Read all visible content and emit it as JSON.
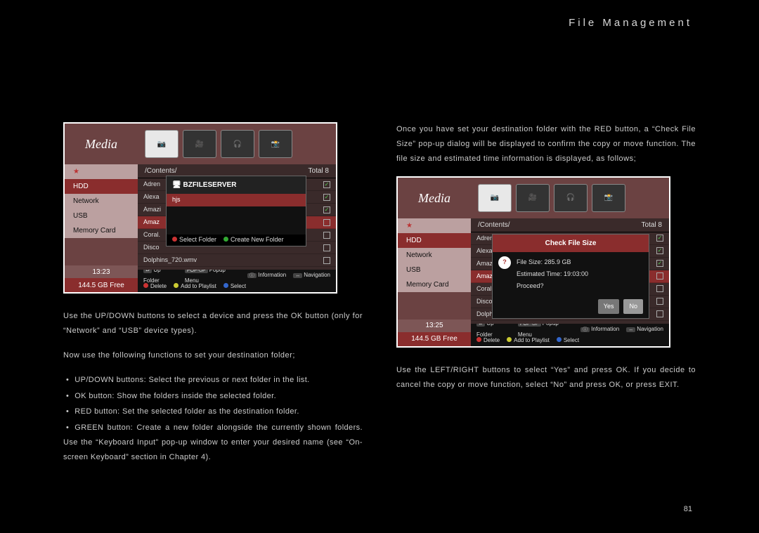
{
  "header": {
    "title": "File Management"
  },
  "page_number": "81",
  "left": {
    "p1": "Use the UP/DOWN buttons to select a device and press the OK button (only for “Network” and “USB” device types).",
    "p2": "Now use the following functions to set your destination folder;",
    "bullets": [
      "UP/DOWN buttons: Select the previous or next folder in the list.",
      "OK button: Show the folders inside the selected folder.",
      "RED button: Set the selected folder as the destination folder.",
      "GREEN button: Create a new folder alongside the currently shown folders.  Use the “Keyboard Input” pop-up window to enter your desired name (see “On-screen Keyboard” section in Chapter 4)."
    ]
  },
  "right": {
    "p1": "Once you have set your destination folder with the RED button, a “Check File Size” pop-up dialog will be displayed to confirm the copy or move function.  The file size and estimated time information is displayed, as follows;",
    "p2": "Use the LEFT/RIGHT buttons to select “Yes” and press OK.  If you decide to cancel the copy or move function, select “No” and press OK, or press EXIT."
  },
  "shot1": {
    "media": "Media",
    "path": "/Contents/",
    "total": "Total 8",
    "side": {
      "hdd": "HDD",
      "net": "Network",
      "usb": "USB",
      "mc": "Memory Card",
      "time": "13:23",
      "free": "144.5 GB Free"
    },
    "rows": [
      "Adren",
      "Alexa",
      "Amazi",
      "Amaz",
      "Coral.",
      "Disco",
      "Dolphins_720.wmv"
    ],
    "popup": {
      "title": "BZFILESERVER",
      "row": "hjs",
      "hints": {
        "select": "Select Folder",
        "create": "Create New Folder"
      }
    },
    "hints": {
      "up": "Up Folder",
      "popup": "Popup Menu",
      "info": "Information",
      "nav": "Navigation",
      "delete": "Delete",
      "add": "Add to Playlist",
      "select": "Select"
    }
  },
  "shot2": {
    "media": "Media",
    "path": "/Contents/",
    "total": "Total 8",
    "side": {
      "hdd": "HDD",
      "net": "Network",
      "usb": "USB",
      "mc": "Memory Card",
      "time": "13:25",
      "free": "144.5 GB Free"
    },
    "rows": [
      "Adren",
      "Alexa",
      "Amazi",
      "Amaz",
      "Coral.",
      "Disco",
      "Dolphins_720.wmv"
    ],
    "popup": {
      "title": "Check File Size",
      "size": "File Size: 285.9 GB",
      "eta": "Estimated Time: 19:03:00",
      "proceed": "Proceed?",
      "yes": "Yes",
      "no": "No"
    },
    "hints": {
      "up": "Up Folder",
      "popup": "Popup Menu",
      "info": "Information",
      "nav": "Navigation",
      "delete": "Delete",
      "add": "Add to Playlist",
      "select": "Select"
    }
  }
}
